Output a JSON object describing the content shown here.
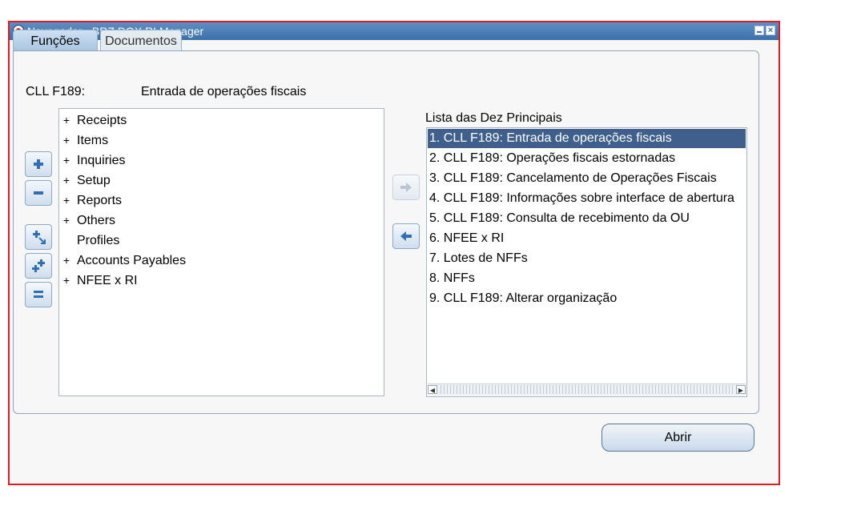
{
  "window": {
    "title": "Navegador - BRZ DOX RI Manager"
  },
  "tabs": [
    {
      "label": "Funções",
      "active": true
    },
    {
      "label": "Documentos",
      "active": false
    }
  ],
  "function": {
    "label": "CLL F189:",
    "name": "Entrada de operações fiscais"
  },
  "tree": {
    "items": [
      {
        "label": "Receipts",
        "expander": "+"
      },
      {
        "label": "Items",
        "expander": "+"
      },
      {
        "label": "Inquiries",
        "expander": "+"
      },
      {
        "label": "Setup",
        "expander": "+"
      },
      {
        "label": "Reports",
        "expander": "+"
      },
      {
        "label": "Others",
        "expander": "+"
      },
      {
        "label": "Profiles",
        "expander": ""
      },
      {
        "label": "Accounts Payables",
        "expander": "+"
      },
      {
        "label": "NFEE x RI",
        "expander": "+"
      }
    ]
  },
  "top_ten": {
    "label": "Lista das Dez Principais",
    "items": [
      "1. CLL F189: Entrada de operações fiscais",
      "2. CLL F189: Operações fiscais estornadas",
      "3. CLL F189: Cancelamento de Operações Fiscais",
      "4. CLL F189: Informações sobre interface de abertura",
      "5. CLL F189: Consulta de recebimento da OU",
      "6. NFEE x RI",
      "7. Lotes de NFFs",
      "8. NFFs",
      "9. CLL F189: Alterar organização"
    ],
    "selected_index": 0
  },
  "buttons": {
    "open_label": "Abrir"
  },
  "colors": {
    "titlebar": "#3d70a8",
    "selection": "#3f5f8c",
    "window_border": "#e31b23"
  }
}
